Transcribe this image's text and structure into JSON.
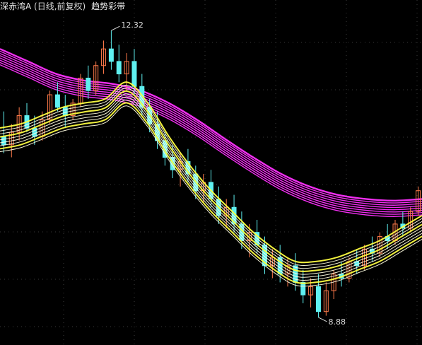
{
  "title": {
    "stock_name": "深赤湾A",
    "period": "(日线,前复权)",
    "indicator": "趋势彩带"
  },
  "chart_data": {
    "type": "candlestick",
    "title": "深赤湾A (日线,前复权) 趋势彩带",
    "ylim": [
      8.6,
      12.5
    ],
    "grid": true,
    "annotations": [
      {
        "label": "12.32",
        "kind": "high"
      },
      {
        "label": "8.88",
        "kind": "low"
      }
    ],
    "colors": {
      "up": "#ff7a4a",
      "down": "#5ff0f0",
      "fast_band": "#ffff40",
      "slow_band": "#ff30ff",
      "background": "#000000"
    },
    "candles": [
      [
        11.05,
        11.35,
        10.85,
        10.95
      ],
      [
        10.95,
        11.2,
        10.8,
        11.1
      ],
      [
        11.1,
        11.4,
        11.0,
        11.3
      ],
      [
        11.3,
        11.45,
        11.1,
        11.15
      ],
      [
        11.15,
        11.3,
        10.95,
        11.05
      ],
      [
        11.05,
        11.35,
        11.0,
        11.25
      ],
      [
        11.25,
        11.6,
        11.2,
        11.55
      ],
      [
        11.55,
        11.7,
        11.35,
        11.4
      ],
      [
        11.4,
        11.55,
        11.15,
        11.3
      ],
      [
        11.3,
        11.5,
        11.25,
        11.45
      ],
      [
        11.45,
        11.8,
        11.4,
        11.75
      ],
      [
        11.75,
        11.9,
        11.5,
        11.6
      ],
      [
        11.6,
        11.95,
        11.55,
        11.9
      ],
      [
        11.9,
        12.2,
        11.8,
        12.1
      ],
      [
        12.1,
        12.32,
        11.85,
        11.95
      ],
      [
        11.95,
        12.15,
        11.7,
        11.8
      ],
      [
        11.8,
        12.05,
        11.6,
        11.95
      ],
      [
        11.95,
        12.1,
        11.55,
        11.65
      ],
      [
        11.65,
        11.8,
        11.3,
        11.4
      ],
      [
        11.4,
        11.5,
        11.1,
        11.2
      ],
      [
        11.2,
        11.35,
        10.9,
        11.0
      ],
      [
        11.0,
        11.1,
        10.7,
        10.8
      ],
      [
        10.8,
        10.95,
        10.55,
        10.65
      ],
      [
        10.65,
        10.85,
        10.45,
        10.75
      ],
      [
        10.75,
        10.9,
        10.5,
        10.6
      ],
      [
        10.6,
        10.7,
        10.3,
        10.4
      ],
      [
        10.4,
        10.6,
        10.25,
        10.5
      ],
      [
        10.5,
        10.65,
        10.2,
        10.3
      ],
      [
        10.3,
        10.45,
        10.0,
        10.1
      ],
      [
        10.1,
        10.3,
        9.95,
        10.2
      ],
      [
        10.2,
        10.35,
        9.9,
        10.0
      ],
      [
        10.0,
        10.15,
        9.7,
        9.8
      ],
      [
        9.8,
        10.0,
        9.6,
        9.9
      ],
      [
        9.9,
        10.05,
        9.65,
        9.75
      ],
      [
        9.75,
        9.85,
        9.4,
        9.5
      ],
      [
        9.5,
        9.7,
        9.35,
        9.6
      ],
      [
        9.6,
        9.75,
        9.3,
        9.4
      ],
      [
        9.4,
        9.6,
        9.25,
        9.5
      ],
      [
        9.5,
        9.65,
        9.2,
        9.3
      ],
      [
        9.3,
        9.45,
        9.05,
        9.15
      ],
      [
        9.15,
        9.35,
        9.0,
        9.25
      ],
      [
        9.25,
        9.4,
        8.88,
        8.95
      ],
      [
        8.95,
        9.3,
        8.9,
        9.2
      ],
      [
        9.2,
        9.45,
        9.1,
        9.4
      ],
      [
        9.4,
        9.55,
        9.25,
        9.35
      ],
      [
        9.35,
        9.6,
        9.3,
        9.55
      ],
      [
        9.55,
        9.7,
        9.4,
        9.5
      ],
      [
        9.5,
        9.75,
        9.45,
        9.7
      ],
      [
        9.7,
        9.85,
        9.55,
        9.65
      ],
      [
        9.65,
        9.9,
        9.6,
        9.85
      ],
      [
        9.85,
        10.0,
        9.7,
        9.8
      ],
      [
        9.8,
        10.05,
        9.75,
        10.0
      ],
      [
        10.0,
        10.15,
        9.85,
        9.95
      ],
      [
        9.95,
        10.2,
        9.9,
        10.15
      ],
      [
        10.15,
        10.45,
        10.1,
        10.4
      ]
    ],
    "fast_band_anchor": [
      11.05,
      11.1,
      11.2,
      11.3,
      11.35,
      11.4,
      11.6,
      11.35,
      10.95,
      10.6,
      10.3,
      10.05,
      9.8,
      9.6,
      9.45,
      9.45,
      9.5,
      9.6,
      9.7,
      9.85,
      10.0
    ],
    "slow_band_anchor": [
      12.1,
      11.95,
      11.8,
      11.72,
      11.68,
      11.6,
      11.45,
      11.25,
      11.02,
      10.8,
      10.6,
      10.45,
      10.35,
      10.3,
      10.28,
      10.3
    ]
  }
}
